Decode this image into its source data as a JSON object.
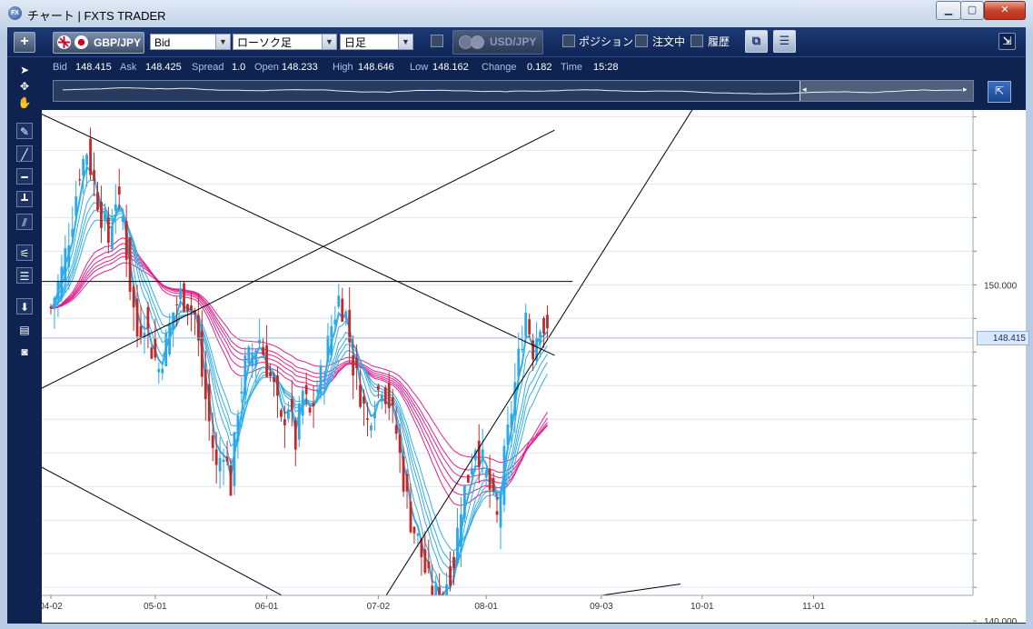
{
  "window": {
    "title": "チャート | FXTS TRADER",
    "icon_text": "FX"
  },
  "toolbar": {
    "add_label": "+",
    "symbol": "GBP/JPY",
    "price_type": "Bid",
    "chart_type": "ローソク足",
    "period": "日足",
    "compare_symbol": "USD/JPY",
    "position_label": "ポジション",
    "order_label": "注文中",
    "history_label": "履歴"
  },
  "info": {
    "bid_label": "Bid",
    "bid": "148.415",
    "ask_label": "Ask",
    "ask": "148.425",
    "spread_label": "Spread",
    "spread": "1.0",
    "open_label": "Open",
    "open": "148.233",
    "high_label": "High",
    "high": "148.646",
    "low_label": "Low",
    "low": "148.162",
    "change_label": "Change",
    "change": "0.182",
    "time_label": "Time",
    "time": "15:28"
  },
  "colors": {
    "bull": "#2aa8e8",
    "bear": "#c22a2a",
    "short_ma": "#33aee6",
    "long_ma": "#e0228e",
    "trendline": "#000000",
    "background": "#ffffff"
  },
  "chart_data": {
    "type": "candlestick",
    "symbol": "GBP/JPY",
    "timeframe": "日足",
    "ylim": [
      139.95,
      155.2
    ],
    "y_ticks": [
      "140.000",
      "150.000"
    ],
    "x_ticks": [
      "04-02",
      "05-01",
      "06-01",
      "07-02",
      "08-01",
      "09-03",
      "10-01",
      "11-01"
    ],
    "last_price": "148.415",
    "path": [
      [
        0,
        149.3
      ],
      [
        3,
        150.4
      ],
      [
        6,
        152.0
      ],
      [
        8,
        153.4
      ],
      [
        10,
        154.0
      ],
      [
        12,
        153.0
      ],
      [
        14,
        152.1
      ],
      [
        16,
        151.3
      ],
      [
        18,
        152.6
      ],
      [
        20,
        152.0
      ],
      [
        22,
        150.0
      ],
      [
        24,
        148.5
      ],
      [
        26,
        149.0
      ],
      [
        28,
        148.1
      ],
      [
        30,
        147.5
      ],
      [
        32,
        148.3
      ],
      [
        34,
        149.2
      ],
      [
        36,
        149.7
      ],
      [
        38,
        149.5
      ],
      [
        40,
        149.1
      ],
      [
        42,
        147.3
      ],
      [
        44,
        145.9
      ],
      [
        46,
        144.5
      ],
      [
        48,
        145.2
      ],
      [
        50,
        144.0
      ],
      [
        52,
        146.4
      ],
      [
        54,
        147.6
      ],
      [
        56,
        148.0
      ],
      [
        58,
        148.4
      ],
      [
        60,
        147.6
      ],
      [
        62,
        146.9
      ],
      [
        64,
        145.8
      ],
      [
        66,
        146.5
      ],
      [
        68,
        145.3
      ],
      [
        70,
        146.8
      ],
      [
        72,
        146.1
      ],
      [
        74,
        146.9
      ],
      [
        76,
        147.6
      ],
      [
        78,
        148.8
      ],
      [
        80,
        149.6
      ],
      [
        82,
        149.1
      ],
      [
        84,
        147.6
      ],
      [
        86,
        146.8
      ],
      [
        88,
        145.9
      ],
      [
        90,
        146.6
      ],
      [
        92,
        147.1
      ],
      [
        94,
        146.5
      ],
      [
        96,
        145.6
      ],
      [
        98,
        144.2
      ],
      [
        100,
        143.0
      ],
      [
        102,
        142.4
      ],
      [
        104,
        141.5
      ],
      [
        106,
        140.8
      ],
      [
        108,
        140.7
      ],
      [
        110,
        141.2
      ],
      [
        112,
        141.8
      ],
      [
        114,
        143.5
      ],
      [
        116,
        144.3
      ],
      [
        118,
        145.3
      ],
      [
        120,
        144.7
      ],
      [
        122,
        143.9
      ],
      [
        124,
        143.0
      ],
      [
        126,
        144.8
      ],
      [
        128,
        146.3
      ],
      [
        130,
        147.8
      ],
      [
        132,
        149.2
      ],
      [
        134,
        148.1
      ],
      [
        136,
        149.0
      ],
      [
        138,
        148.4
      ]
    ],
    "trendlines": [
      {
        "from": [
          -3,
          155.1
        ],
        "to": [
          140,
          147.9
        ]
      },
      {
        "from": [
          -3,
          146.9
        ],
        "to": [
          140,
          154.6
        ]
      },
      {
        "from": [
          -3,
          144.6
        ],
        "to": [
          81,
          139.8
        ]
      },
      {
        "from": [
          84,
          139.2
        ],
        "to": [
          180,
          155.5
        ]
      },
      {
        "from": [
          52,
          139.2
        ],
        "to": [
          175,
          141.1
        ]
      },
      {
        "from": [
          -3,
          150.1
        ],
        "to": [
          145,
          150.1
        ]
      },
      {
        "from": [
          -3,
          139.9
        ],
        "to": [
          170,
          139.9
        ]
      }
    ]
  }
}
